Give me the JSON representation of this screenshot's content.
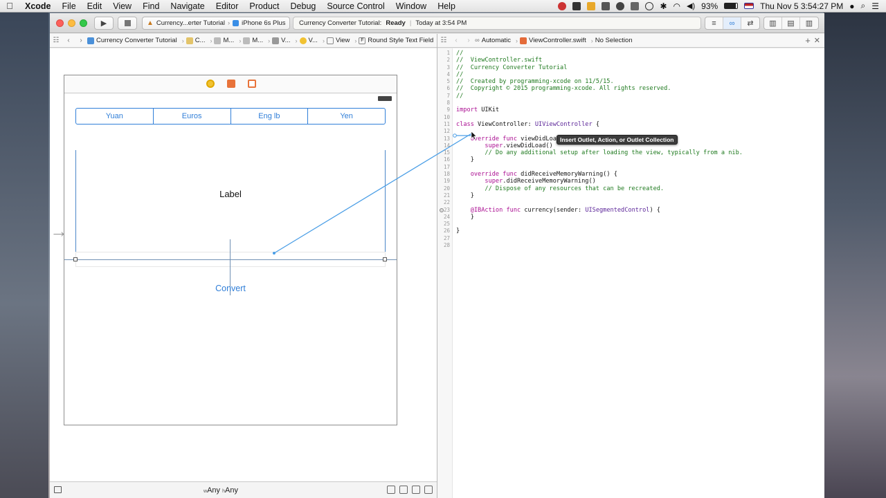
{
  "menubar": {
    "apple_icon": "apple-logo",
    "app_name": "Xcode",
    "items": [
      "File",
      "Edit",
      "View",
      "Find",
      "Navigate",
      "Editor",
      "Product",
      "Debug",
      "Source Control",
      "Window",
      "Help"
    ],
    "battery": "93%",
    "datetime": "Thu Nov 5  3:54:27 PM"
  },
  "toolbar": {
    "scheme_target": "Currency...erter Tutorial",
    "scheme_device": "iPhone 6s Plus",
    "activity_project": "Currency Converter Tutorial:",
    "activity_status": "Ready",
    "activity_time": "Today at 3:54 PM"
  },
  "ib_jumpbar": {
    "items": [
      "Currency Converter Tutorial",
      "C...",
      "M...",
      "M...",
      "V...",
      "V...",
      "View",
      "Round Style Text Field"
    ]
  },
  "code_jumpbar": {
    "mode": "Automatic",
    "file": "ViewController.swift",
    "selection": "No Selection"
  },
  "scene": {
    "segments": [
      "Yuan",
      "Euros",
      "Eng lb",
      "Yen"
    ],
    "label_text": "Label",
    "convert_button": "Convert"
  },
  "size_class": {
    "w_prefix": "w",
    "w_value": "Any",
    "h_prefix": "h",
    "h_value": "Any"
  },
  "tooltip": "Insert Outlet, Action, or Outlet Collection",
  "code_lines": [
    {
      "n": "1",
      "html": "<span class='cm'>//</span>"
    },
    {
      "n": "2",
      "html": "<span class='cm'>//  ViewController.swift</span>"
    },
    {
      "n": "3",
      "html": "<span class='cm'>//  Currency Converter Tutorial</span>"
    },
    {
      "n": "4",
      "html": "<span class='cm'>//</span>"
    },
    {
      "n": "5",
      "html": "<span class='cm'>//  Created by programming-xcode on 11/5/15.</span>"
    },
    {
      "n": "6",
      "html": "<span class='cm'>//  Copyright © 2015 programming-xcode. All rights reserved.</span>"
    },
    {
      "n": "7",
      "html": "<span class='cm'>//</span>"
    },
    {
      "n": "8",
      "html": ""
    },
    {
      "n": "9",
      "html": "<span class='kw'>import</span> UIKit"
    },
    {
      "n": "10",
      "html": ""
    },
    {
      "n": "11",
      "html": "<span class='kw'>class</span> ViewController: <span class='ty'>UIViewController</span> {"
    },
    {
      "n": "12",
      "html": ""
    },
    {
      "n": "13",
      "html": "    <span class='kw'>override</span> <span class='kw'>func</span> viewDidLoad() {"
    },
    {
      "n": "14",
      "html": "        <span class='kw'>super</span>.viewDidLoad()"
    },
    {
      "n": "15",
      "html": "        <span class='cm'>// Do any additional setup after loading the view, typically from a nib.</span>"
    },
    {
      "n": "16",
      "html": "    }"
    },
    {
      "n": "17",
      "html": ""
    },
    {
      "n": "18",
      "html": "    <span class='kw'>override</span> <span class='kw'>func</span> didReceiveMemoryWarning() {"
    },
    {
      "n": "19",
      "html": "        <span class='kw'>super</span>.didReceiveMemoryWarning()"
    },
    {
      "n": "20",
      "html": "        <span class='cm'>// Dispose of any resources that can be recreated.</span>"
    },
    {
      "n": "21",
      "html": "    }"
    },
    {
      "n": "22",
      "html": ""
    },
    {
      "n": "23",
      "html": "    <span class='at'>@IBAction</span> <span class='kw'>func</span> currency(sender: <span class='ty'>UISegmentedControl</span>) {"
    },
    {
      "n": "24",
      "html": "    }"
    },
    {
      "n": "25",
      "html": ""
    },
    {
      "n": "26",
      "html": "}"
    },
    {
      "n": "27",
      "html": ""
    },
    {
      "n": "28",
      "html": ""
    }
  ],
  "colors": {
    "accent": "#2f7ed8",
    "comment": "#1f7a1f",
    "keyword": "#aa0d91",
    "type": "#5c2699"
  }
}
